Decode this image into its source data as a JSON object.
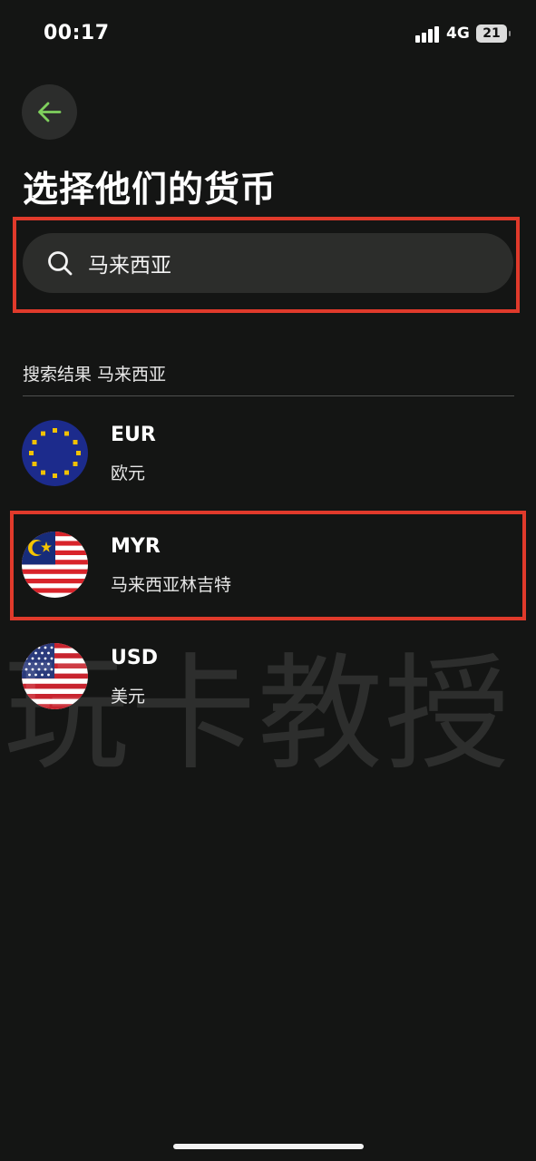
{
  "status_bar": {
    "time": "00:17",
    "network": "4G",
    "battery": "21"
  },
  "header": {
    "back_icon": "arrow-left-icon",
    "title": "选择他们的货币"
  },
  "search": {
    "value": "马来西亚",
    "placeholder": ""
  },
  "results": {
    "heading": "搜索结果 马来西亚",
    "items": [
      {
        "code": "EUR",
        "name": "欧元",
        "flag": "eu-flag-icon"
      },
      {
        "code": "MYR",
        "name": "马来西亚林吉特",
        "flag": "malaysia-flag-icon"
      },
      {
        "code": "USD",
        "name": "美元",
        "flag": "us-flag-icon"
      }
    ]
  },
  "watermark": "玩卡教授",
  "colors": {
    "background": "#141514",
    "accent": "#7fd05d",
    "highlight": "#e03a2b",
    "surface": "#2c2d2b"
  }
}
